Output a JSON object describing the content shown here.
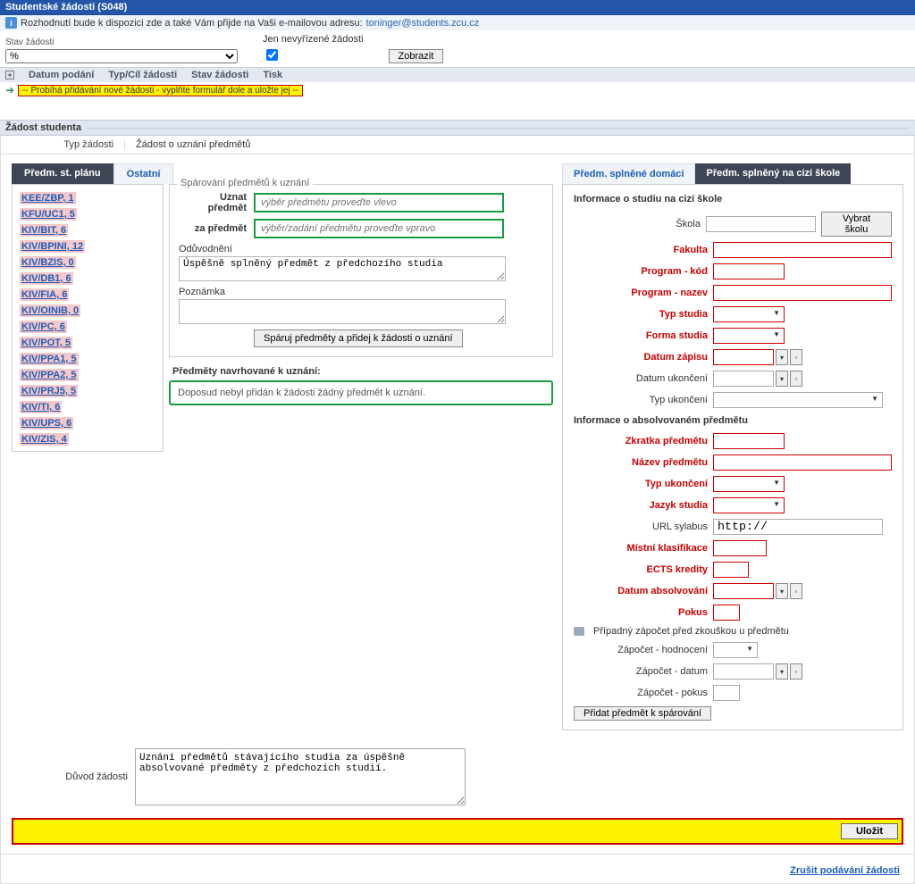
{
  "window_title": "Studentské žádosti (S048)",
  "info_text": "Rozhodnutí bude k dispozici zde a také Vám přijde na Vaši e-mailovou adresu:",
  "info_email": "toninger@students.zcu.cz",
  "filter": {
    "stav_label": "Stav žádosti",
    "stav_value": "%",
    "only_unresolved_label": "Jen nevyřízené žádosti",
    "show_btn": "Zobrazit"
  },
  "grid": {
    "cols": {
      "datum": "Datum podání",
      "typ": "Typ/Cíl žádosti",
      "stav": "Stav žádosti",
      "tisk": "Tisk"
    },
    "pending_msg": "-- Probíhá přidávání nové žádosti - vyplňte formulář dole a uložte jej --"
  },
  "zadost_tab": "Žádost studenta",
  "typ_row": {
    "label": "Typ žádosti",
    "value": "Žádost o uznání předmětů"
  },
  "left": {
    "tab_plan": "Předm. st. plánu",
    "tab_other": "Ostatní",
    "subjects": [
      "KEE/ZBP, 1",
      "KFU/UC1, 5",
      "KIV/BIT, 6",
      "KIV/BPINI, 12",
      "KIV/BZIS, 0",
      "KIV/DB1, 6",
      "KIV/FIA, 6",
      "KIV/OINIB, 0",
      "KIV/PC, 6",
      "KIV/POT, 5",
      "KIV/PPA1, 5",
      "KIV/PPA2, 5",
      "KIV/PRJ5, 5",
      "KIV/TI, 6",
      "KIV/UPS, 6",
      "KIV/ZIS, 4"
    ],
    "pair_legend": "Spárování předmětů k uznání",
    "uznat_label": "Uznat předmět",
    "uznat_placeholder": "výběr předmětu proveďte vlevo",
    "za_label": "za předmět",
    "za_placeholder": "výběr/zadání předmětu proveďte vpravo",
    "oduvod_label": "Odůvodnění",
    "oduvod_value": "Úspěšně splněný předmět z předchozího studia",
    "pozn_label": "Poznámka",
    "pair_btn": "Spáruj předměty a přidej k žádosti o uznání",
    "proposed_title": "Předměty navrhované k uznání:",
    "proposed_empty": "Doposud nebyl přidán k žádosti žádný předmět k uznání."
  },
  "right": {
    "tab_home": "Předm. splněné domácí",
    "tab_foreign": "Předm. splněný na cizí škole",
    "study_title": "Informace o studiu na cizí škole",
    "skola_label": "Škola",
    "skola_btn": "Vybrat školu",
    "fakulta_label": "Fakulta",
    "program_kod_label": "Program - kód",
    "program_nazev_label": "Program - nazev",
    "typ_studia_label": "Typ studia",
    "forma_studia_label": "Forma studia",
    "datum_zapisu_label": "Datum zápisu",
    "datum_ukonceni_label": "Datum ukončení",
    "typ_ukonceni_label": "Typ ukončení",
    "subject_title": "Informace o absolvovaném předmětu",
    "zkratka_label": "Zkratka předmětu",
    "nazev_pred_label": "Název předmětu",
    "typ_ukon_label": "Typ ukončení",
    "jazyk_label": "Jazyk studia",
    "url_label": "URL sylabus",
    "url_value": "http://",
    "mistni_klas_label": "Místní klasifikace",
    "ects_label": "ECTS kredity",
    "datum_abs_label": "Datum absolvování",
    "pokus_label": "Pokus",
    "zapocet_note": "Případný zápočet před zkouškou u předmětu",
    "zap_hodn_label": "Zápočet - hodnocení",
    "zap_datum_label": "Zápočet - datum",
    "zap_pokus_label": "Zápočet - pokus",
    "add_btn": "Přidat předmět k spárování"
  },
  "bottom": {
    "reason_label": "Důvod žádosti",
    "reason_value": "Uznání předmětů stávajícího studia za úspěšně absolvované předměty z předchozích studií.",
    "save_btn": "Uložit",
    "cancel_link": "Zrušit podávání žádosti"
  }
}
